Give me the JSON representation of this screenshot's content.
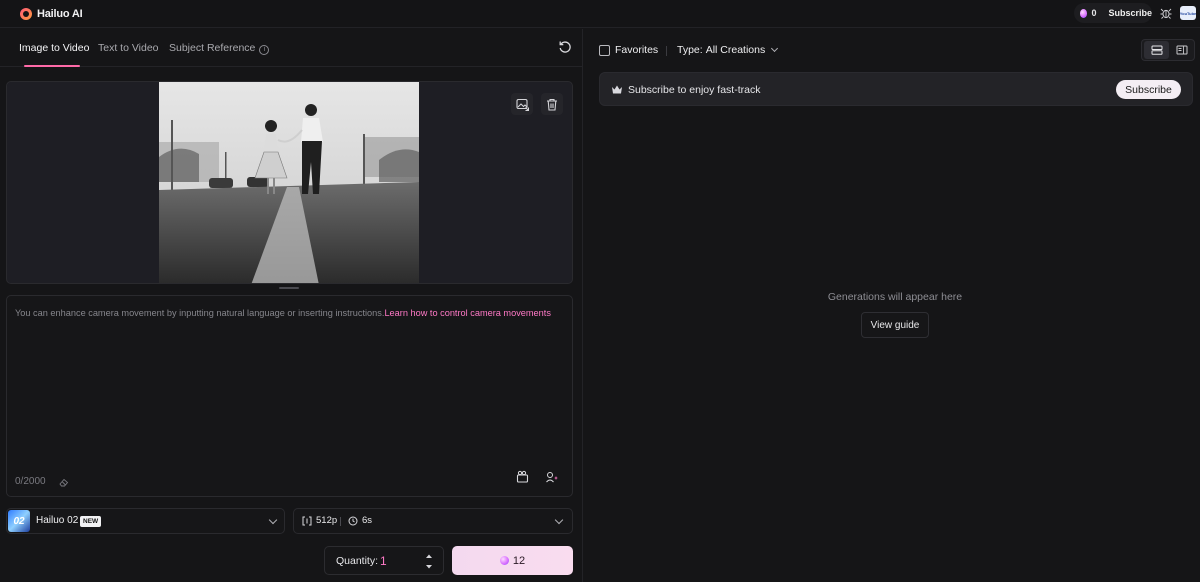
{
  "brand": {
    "name": "Hailuo AI"
  },
  "header": {
    "credits": "0",
    "subscribe_label": "Subscribe",
    "avatar_text": "YouTube"
  },
  "tabs": [
    {
      "label": "Image to Video"
    },
    {
      "label": "Text to Video"
    },
    {
      "label": "Subject Reference"
    }
  ],
  "prompt": {
    "hint": "You can enhance camera movement by inputting natural language or inserting instructions.",
    "link": "Learn how to control camera movements",
    "char_count": "0/2000"
  },
  "model": {
    "thumb_text": "02",
    "name": "Hailuo 02",
    "badge": "NEW"
  },
  "settings": {
    "resolution": "512p",
    "duration": "6s"
  },
  "quantity": {
    "label": "Quantity:",
    "value": "1"
  },
  "generate": {
    "cost": "12"
  },
  "right": {
    "favorites_label": "Favorites",
    "type_label": "Type:",
    "type_value": "All Creations",
    "banner_text": "Subscribe to enjoy fast-track",
    "banner_button": "Subscribe",
    "empty_text": "Generations will appear here",
    "guide_button": "View guide"
  },
  "colors": {
    "accent": "#ff6aa8",
    "link": "#ff79c6",
    "background": "#151517",
    "generate": "#f4d9ef"
  },
  "icons": [
    "logo-icon",
    "gem-icon",
    "bug-icon",
    "info-icon",
    "reset-icon",
    "replace-image-icon",
    "trash-icon",
    "eraser-icon",
    "camera-icon",
    "magic-icon",
    "resolution-icon",
    "clock-icon",
    "crown-icon",
    "list-view-icon",
    "panel-view-icon"
  ]
}
